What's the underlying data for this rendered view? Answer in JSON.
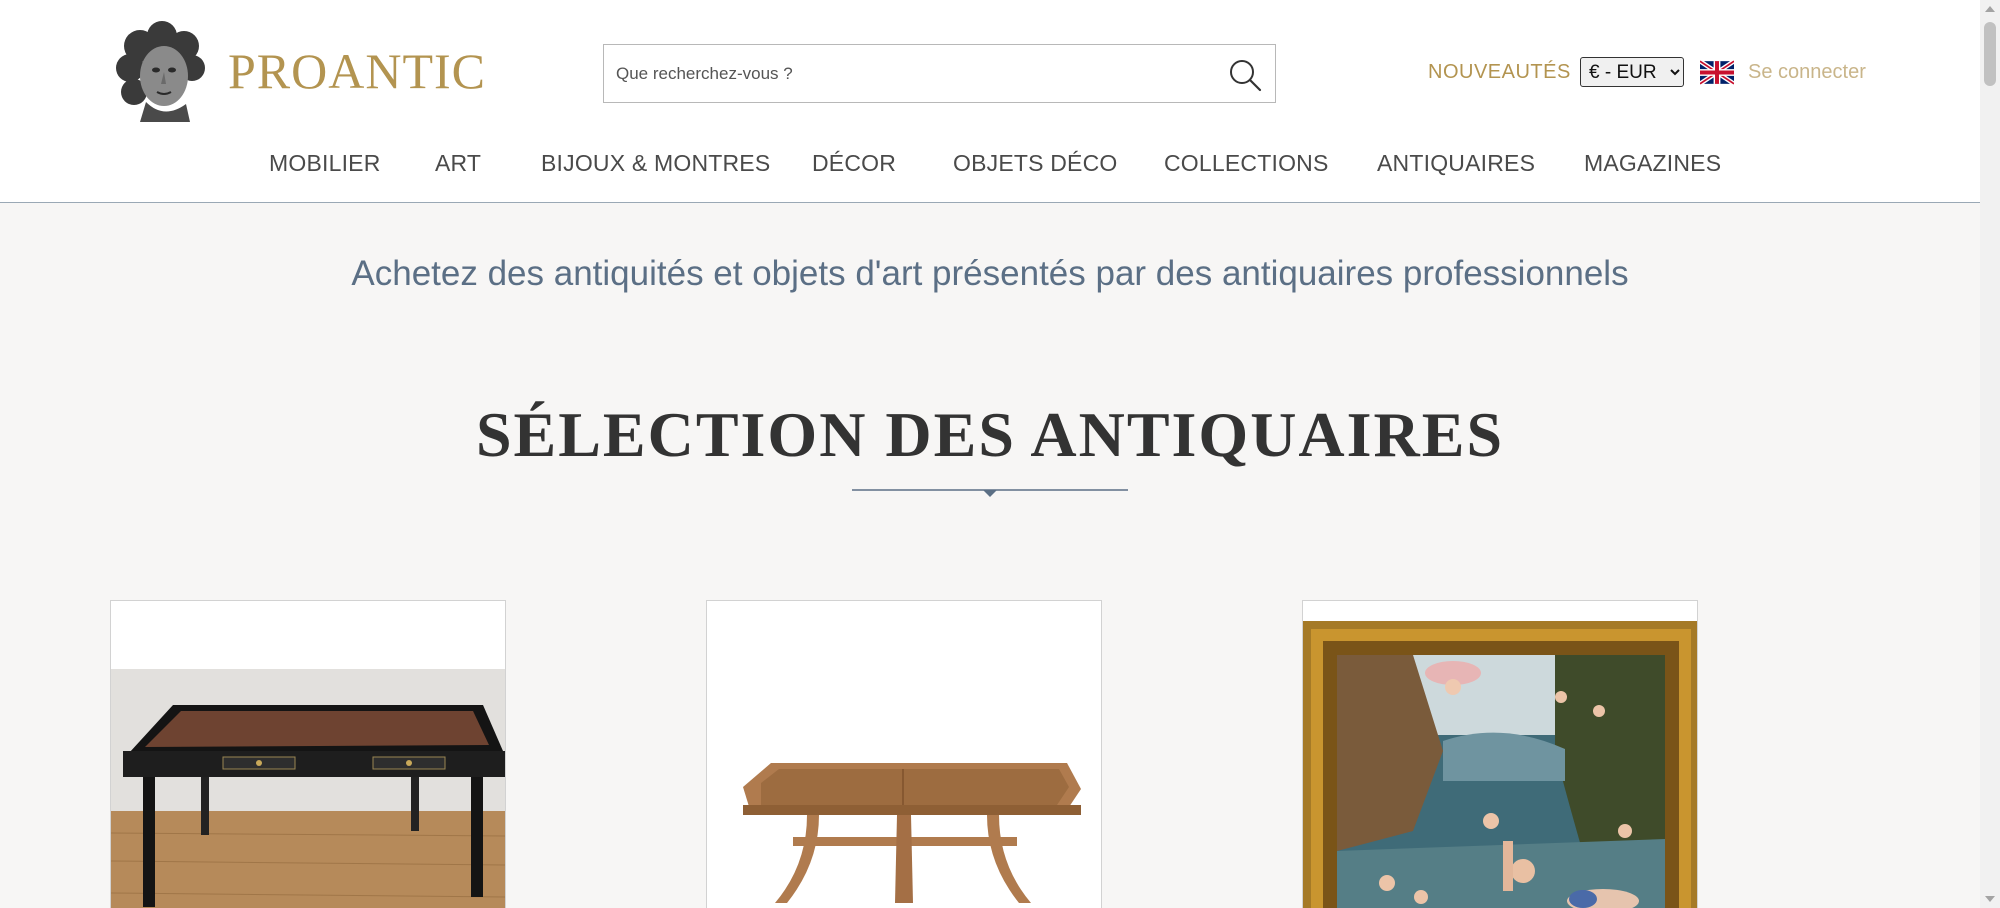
{
  "header": {
    "logo_text": "PROANTIC",
    "search_placeholder": "Que recherchez-vous ?",
    "nouveautes": "NOUVEAUTÉS",
    "currency_selected": "€ - EUR",
    "login": "Se connecter"
  },
  "nav": {
    "items": [
      "MOBILIER",
      "ART",
      "BIJOUX & MONTRES",
      "DÉCOR",
      "OBJETS DÉCO",
      "COLLECTIONS",
      "ANTIQUAIRES",
      "MAGAZINES"
    ]
  },
  "tagline": "Achetez des antiquités et objets d'art présentés par des antiquaires professionnels",
  "section_title": "SÉLECTION DES ANTIQUAIRES",
  "colors": {
    "gold": "#b39450",
    "login_gold": "#c9b58a",
    "tagline_blue": "#5b6f85",
    "divider": "#5b6f85"
  },
  "icons": [
    "logo-bust-icon",
    "search-icon",
    "uk-flag-icon"
  ]
}
